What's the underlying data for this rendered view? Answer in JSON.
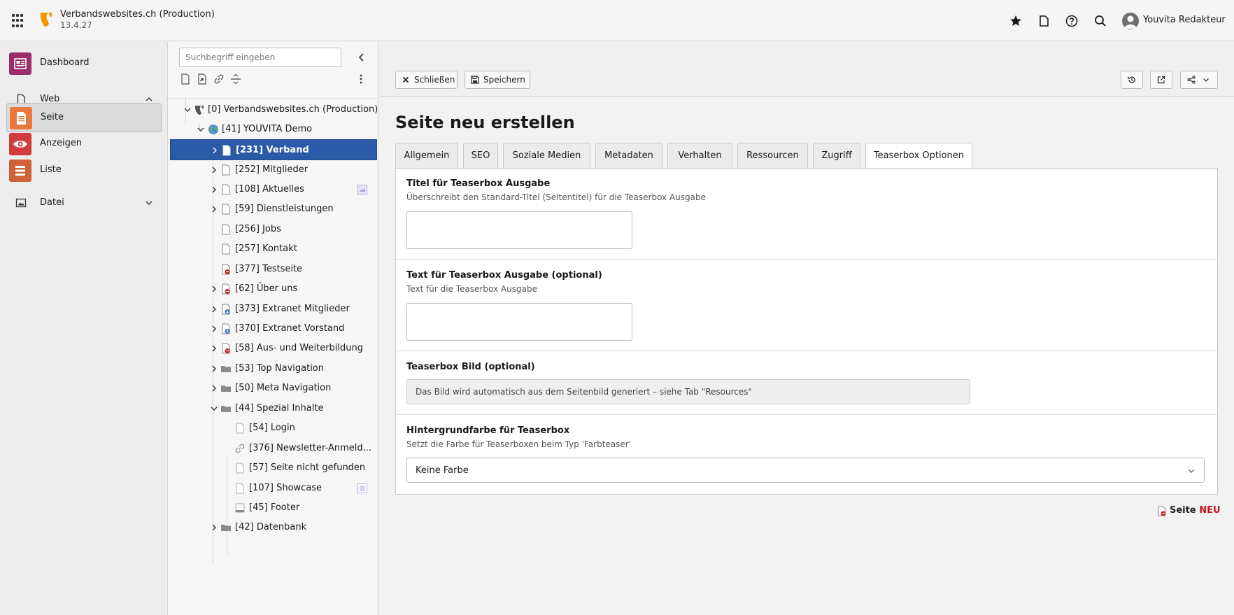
{
  "topbar": {
    "site_title": "Verbandswebsites.ch (Production)",
    "version": "13.4.27",
    "user_name": "Youvita Redakteur",
    "icons": [
      "module-grid-icon",
      "bookmark-star-icon",
      "open-docs-icon",
      "help-icon",
      "search-icon",
      "user-avatar-icon"
    ]
  },
  "modules": {
    "dashboard": "Dashboard",
    "web": "Web",
    "page": "Seite",
    "view": "Anzeigen",
    "list": "Liste",
    "file": "Datei"
  },
  "tree": {
    "search_placeholder": "Suchbegriff eingeben",
    "items": [
      {
        "label": "[0] Verbandswebsites.ch (Production)"
      },
      {
        "label": "[41] YOUVITA Demo"
      },
      {
        "label": "[231] Verband"
      },
      {
        "label": "[252] Mitglieder"
      },
      {
        "label": "[108] Aktuelles"
      },
      {
        "label": "[59] Dienstleistungen"
      },
      {
        "label": "[256] Jobs"
      },
      {
        "label": "[257] Kontakt"
      },
      {
        "label": "[377] Testseite"
      },
      {
        "label": "[62] Über uns"
      },
      {
        "label": "[373] Extranet Mitglieder"
      },
      {
        "label": "[370] Extranet Vorstand"
      },
      {
        "label": "[58] Aus- und Weiterbildung"
      },
      {
        "label": "[53] Top Navigation"
      },
      {
        "label": "[50] Meta Navigation"
      },
      {
        "label": "[44] Spezial Inhalte"
      },
      {
        "label": "[54] Login"
      },
      {
        "label": "[376] Newsletter-Anmeld..."
      },
      {
        "label": "[57] Seite nicht gefunden"
      },
      {
        "label": "[107] Showcase"
      },
      {
        "label": "[45] Footer"
      },
      {
        "label": "[42] Datenbank"
      }
    ]
  },
  "docheader": {
    "close_label": "Schließen",
    "save_label": "Speichern"
  },
  "page_title": "Seite neu erstellen",
  "tabs": [
    {
      "label": "Allgemein"
    },
    {
      "label": "SEO"
    },
    {
      "label": "Soziale Medien"
    },
    {
      "label": "Metadaten"
    },
    {
      "label": "Verhalten"
    },
    {
      "label": "Ressourcen"
    },
    {
      "label": "Zugriff"
    },
    {
      "label": "Teaserbox Optionen"
    }
  ],
  "form": {
    "title_label": "Titel für Teaserbox Ausgabe",
    "title_desc": "Überschreibt den Standard-Titel (Seitentitel) für die Teaserbox Ausgabe",
    "title_value": "",
    "text_label": "Text für Teaserbox Ausgabe (optional)",
    "text_desc": "Text für die Teaserbox Ausgabe",
    "text_value": "",
    "image_label": "Teaserbox Bild (optional)",
    "image_note": "Das Bild wird automatisch aus dem Seitenbild generiert – siehe Tab \"Resources\"",
    "bg_label": "Hintergrundfarbe für Teaserbox",
    "bg_desc": "Setzt die Farbe für Teaserboxen beim Typ 'Farbteaser'",
    "bg_value": "Keine Farbe"
  },
  "new_record": {
    "table": "Seite",
    "tag": "NEU"
  },
  "colors": {
    "accent": "#2a5aa8",
    "dashboard_icon": "#9b2d6a",
    "page_icon": "#e8793a",
    "view_icon": "#d23b3b",
    "list_icon": "#d0623a",
    "new_tag": "#c0121c"
  }
}
